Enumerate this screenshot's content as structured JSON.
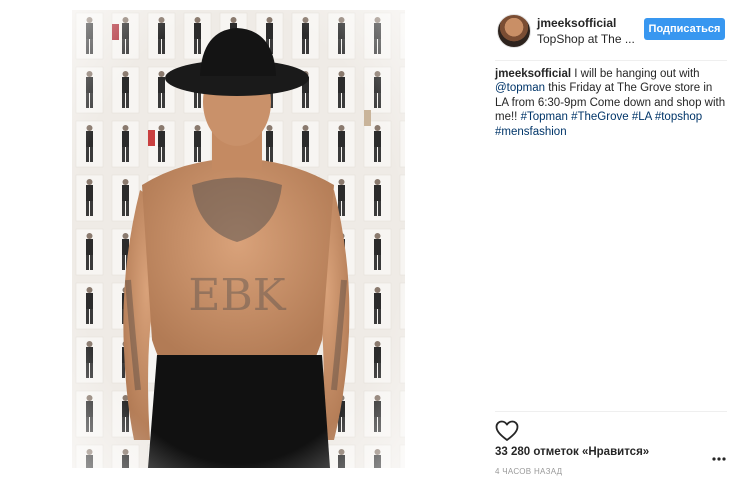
{
  "post": {
    "image_alt": "shirtless man in black hat in front of fashion lookbook wall",
    "username": "jmeeksofficial",
    "location": "TopShop at The ...",
    "follow_label": "Подписаться",
    "caption": {
      "user": "jmeeksofficial",
      "t1": " I will be hanging out with ",
      "mention": "@topman",
      "t2": " this Friday at The Grove store in LA from 6:30-9pm Come down and shop with me!! ",
      "h1": "#Topman",
      "h2": "#TheGrove",
      "h3": "#LA",
      "h4": "#topshop",
      "h5": "#mensfashion"
    },
    "likes": "33 280 отметок «Нравится»",
    "timestamp": "4 ЧАСОВ НАЗАД"
  },
  "icons": {
    "like": "heart-icon",
    "more": "more-options-icon"
  },
  "colors": {
    "accent": "#3897f0",
    "link": "#003569",
    "text": "#262626",
    "muted": "#999999"
  }
}
